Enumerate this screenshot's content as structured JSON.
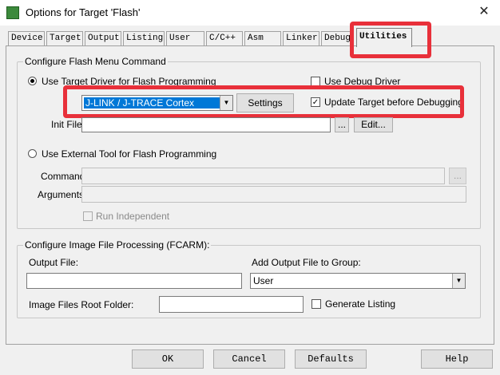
{
  "window": {
    "title": "Options for Target 'Flash'",
    "close_symbol": "✕"
  },
  "tabs": [
    {
      "label": "Device"
    },
    {
      "label": "Target"
    },
    {
      "label": "Output"
    },
    {
      "label": "Listing"
    },
    {
      "label": "User"
    },
    {
      "label": "C/C++"
    },
    {
      "label": "Asm"
    },
    {
      "label": "Linker"
    },
    {
      "label": "Debug"
    },
    {
      "label": "Utilities"
    }
  ],
  "active_tab": "Utilities",
  "flash_menu": {
    "group_label": "Configure Flash Menu Command",
    "use_target_driver_label": "Use Target Driver for Flash Programming",
    "use_target_driver_selected": true,
    "use_debug_driver_label": "Use Debug Driver",
    "use_debug_driver_checked": false,
    "driver_select_value": "J-LINK / J-TRACE Cortex",
    "settings_label": "Settings",
    "update_target_label": "Update Target before Debugging",
    "update_target_checked": true,
    "init_file_label": "Init File:",
    "init_file_value": "",
    "browse_label": "...",
    "edit_label": "Edit...",
    "use_external_tool_label": "Use External Tool for Flash Programming",
    "use_external_tool_selected": false,
    "command_label": "Command:",
    "command_value": "",
    "arguments_label": "Arguments:",
    "arguments_value": "",
    "run_independent_label": "Run Independent",
    "run_independent_checked": false
  },
  "image_processing": {
    "group_label": "Configure Image File Processing (FCARM):",
    "output_file_label": "Output File:",
    "output_file_value": "",
    "add_output_label": "Add Output File  to Group:",
    "group_select_value": "User",
    "root_folder_label": "Image Files Root Folder:",
    "root_folder_value": "",
    "generate_listing_label": "Generate Listing",
    "generate_listing_checked": false
  },
  "footer": {
    "ok_label": "OK",
    "cancel_label": "Cancel",
    "defaults_label": "Defaults",
    "help_label": "Help"
  },
  "highlight_color": "#e8303a",
  "selection_color": "#0078d7"
}
